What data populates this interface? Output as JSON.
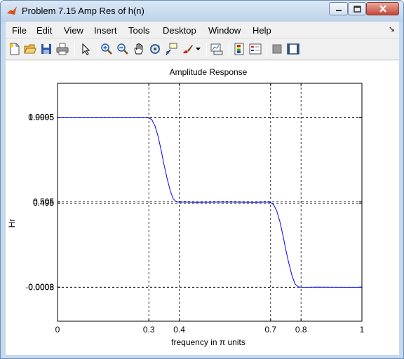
{
  "window": {
    "title": "Problem 7.15 Amp Res of h(n)",
    "icon": "matlab-figure-icon",
    "caption_buttons": [
      "minimize-icon",
      "maximize-icon",
      "close-icon"
    ]
  },
  "menubar": {
    "items": [
      "File",
      "Edit",
      "View",
      "Insert",
      "Tools",
      "Desktop",
      "Window",
      "Help"
    ],
    "dock_arrow": "↘"
  },
  "toolbar": {
    "icons": [
      "new-figure-icon",
      "open-file-icon",
      "save-icon",
      "print-icon",
      "edit-plot-arrow-icon",
      "zoom-in-icon",
      "zoom-out-icon",
      "pan-hand-icon",
      "rotate-3d-icon",
      "data-cursor-icon",
      "brush-icon",
      "brush-dropdown-icon",
      "link-plot-icon",
      "insert-colorbar-icon",
      "insert-legend-icon",
      "hide-plot-tools-icon",
      "show-plot-tools-icon"
    ]
  },
  "colors": {
    "line": "#0000ff",
    "grid": "#000000",
    "axes_bg": "#ffffff",
    "figure_bg": "#ffffff"
  },
  "chart_data": {
    "type": "line",
    "title": "Amplitude Response",
    "xlabel": "frequency in π units",
    "ylabel": "Hr",
    "xlim": [
      0,
      1
    ],
    "ylim": [
      -0.2,
      1.2
    ],
    "xticks": [
      0,
      0.3,
      0.4,
      0.7,
      0.8,
      1
    ],
    "xtick_labels": [
      "0",
      "0.3",
      "0.4",
      "0.7",
      "0.8",
      "1"
    ],
    "yticks": [
      -0.0008,
      0.0008,
      0.495,
      0.505,
      0.9995,
      1.0005
    ],
    "ytick_labels": [
      "-0.0008",
      "0.0008",
      "0.495",
      "0.505",
      "0.9995",
      "1.0005"
    ],
    "grid": "dashed lines at tick positions",
    "series": [
      {
        "x": [
          0,
          0.29,
          0.3,
          0.31,
          0.32,
          0.33,
          0.34,
          0.35,
          0.36,
          0.37,
          0.38,
          0.39,
          0.4,
          0.42,
          0.45,
          0.5,
          0.55,
          0.6,
          0.65,
          0.69,
          0.7,
          0.71,
          0.72,
          0.73,
          0.74,
          0.75,
          0.76,
          0.77,
          0.78,
          0.79,
          0.8,
          0.82,
          0.85,
          0.9,
          0.95,
          1
        ],
        "y": [
          1.0,
          1.0,
          0.998,
          0.985,
          0.95,
          0.89,
          0.81,
          0.72,
          0.64,
          0.57,
          0.52,
          0.503,
          0.5,
          0.501,
          0.499,
          0.5,
          0.501,
          0.5,
          0.499,
          0.501,
          0.498,
          0.485,
          0.45,
          0.39,
          0.31,
          0.22,
          0.14,
          0.07,
          0.02,
          0.003,
          0.0,
          -0.0005,
          0.0005,
          0.0,
          -0.0005,
          0.0
        ]
      }
    ]
  }
}
